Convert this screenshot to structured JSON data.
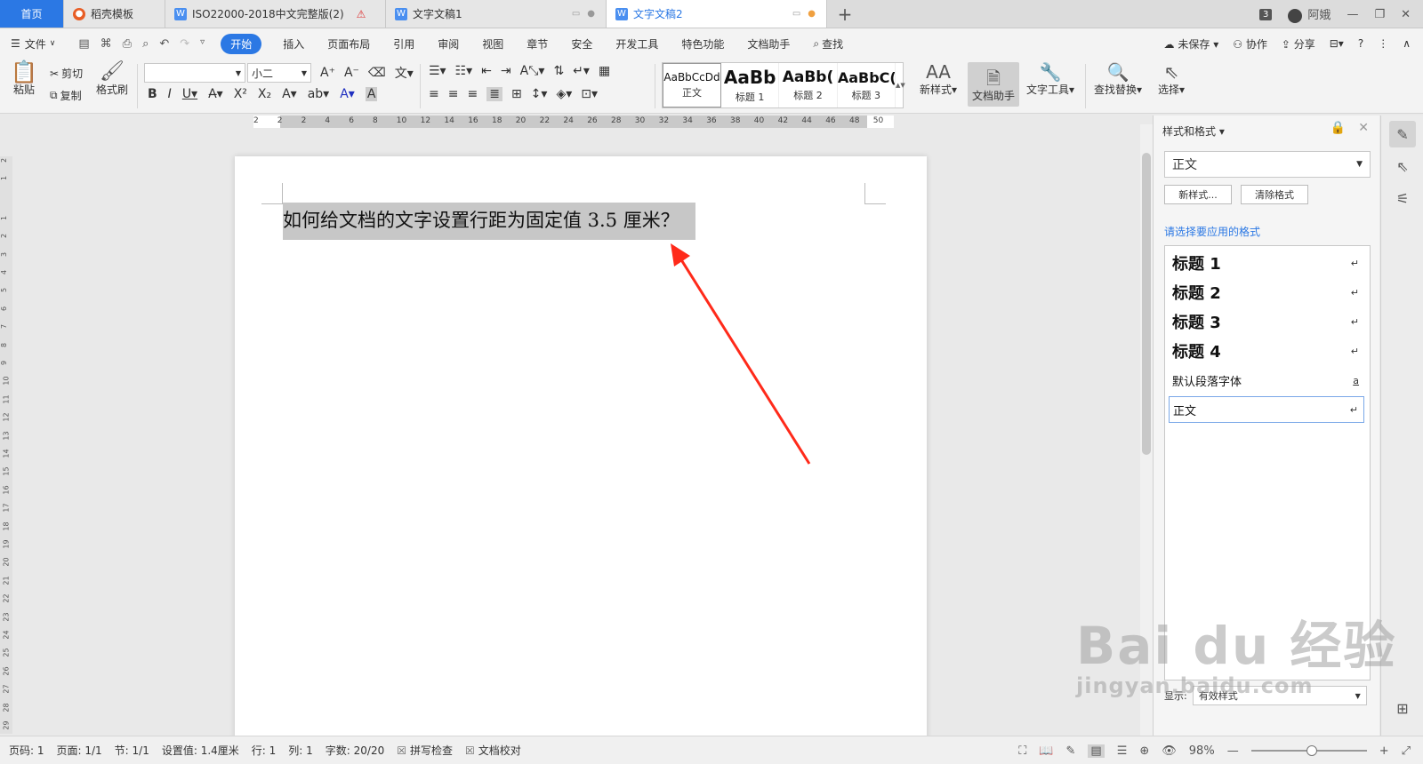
{
  "tabs": {
    "home": "首页",
    "template": "稻壳模板",
    "doc1": "ISO22000-2018中文完整版(2)",
    "doc2": "文字文稿1",
    "doc3": "文字文稿2"
  },
  "window": {
    "badge": "3",
    "user": "阿娥"
  },
  "menu": {
    "file": "文件",
    "items": [
      "开始",
      "插入",
      "页面布局",
      "引用",
      "审阅",
      "视图",
      "章节",
      "安全",
      "开发工具",
      "特色功能",
      "文档助手"
    ],
    "find": "查找",
    "unsaved": "未保存",
    "collab": "协作",
    "share": "分享"
  },
  "ribbon": {
    "paste": "粘贴",
    "cut": "剪切",
    "copy": "复制",
    "format_painter": "格式刷",
    "font_name": "",
    "font_size": "小二",
    "styles": [
      {
        "preview": "AaBbCcDd",
        "name": "正文"
      },
      {
        "preview": "AaBb",
        "name": "标题 1"
      },
      {
        "preview": "AaBb(",
        "name": "标题 2"
      },
      {
        "preview": "AaBbC(",
        "name": "标题 3"
      }
    ],
    "new_style": "新样式",
    "doc_assistant": "文档助手",
    "text_tools": "文字工具",
    "find_replace": "查找替换",
    "select": "选择"
  },
  "document": {
    "text": "如何给文档的文字设置行距为固定值 3.5 厘米？"
  },
  "panel": {
    "title": "样式和格式",
    "current_style": "正文",
    "new_style_btn": "新样式...",
    "clear_format_btn": "清除格式",
    "apply_label": "请选择要应用的格式",
    "items": [
      {
        "label": "标题  1",
        "mark": "↵"
      },
      {
        "label": "标题  2",
        "mark": "↵"
      },
      {
        "label": "标题  3",
        "mark": "↵"
      },
      {
        "label": "标题  4",
        "mark": "↵"
      },
      {
        "label": "默认段落字体",
        "mark": "a"
      },
      {
        "label": "正文",
        "mark": "↵"
      }
    ],
    "show_label": "显示:",
    "show_value": "有效样式"
  },
  "watermark": {
    "logo": "Bai du 经验",
    "url": "jingyan.baidu.com"
  },
  "status": {
    "page_code": "页码: 1",
    "pages": "页面: 1/1",
    "section": "节: 1/1",
    "setting": "设置值: 1.4厘米",
    "row": "行: 1",
    "col": "列: 1",
    "words": "字数: 20/20",
    "spell": "拼写检查",
    "proof": "文档校对",
    "zoom": "98%"
  },
  "ruler": {
    "h_ticks": [
      "2",
      "2",
      "2",
      "4",
      "6",
      "8",
      "10",
      "12",
      "14",
      "16",
      "18",
      "20",
      "22",
      "24",
      "26",
      "28",
      "30",
      "32",
      "34",
      "36",
      "38",
      "40",
      "42",
      "44",
      "46",
      "48",
      "50"
    ],
    "v_ticks": [
      "2",
      "1",
      "1",
      "2",
      "3",
      "4",
      "5",
      "6",
      "7",
      "8",
      "9",
      "10",
      "11",
      "12",
      "13",
      "14",
      "15",
      "16",
      "17",
      "18",
      "19",
      "20",
      "21",
      "22",
      "23",
      "24",
      "25",
      "26",
      "27",
      "28",
      "29"
    ]
  }
}
